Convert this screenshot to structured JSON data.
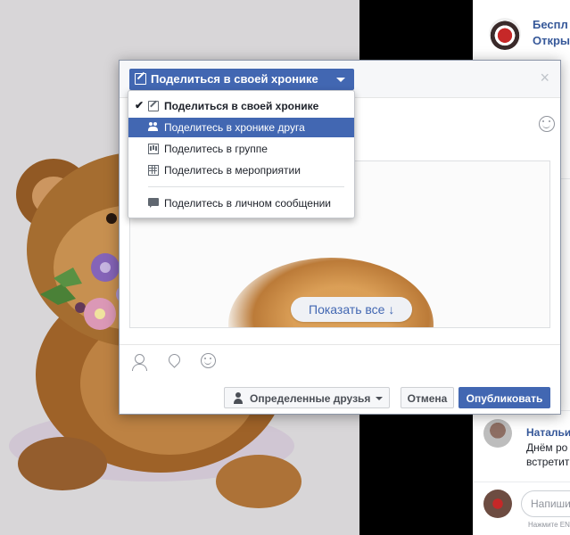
{
  "share_dialog": {
    "title": "Поделиться в своей хронике",
    "close_symbol": "×",
    "attachment": {
      "show_all_label": "Показать все ↓"
    },
    "toolbar_icons": [
      "tag-friends-icon",
      "location-icon",
      "emoji-icon"
    ],
    "audience_label": "Определенные друзья",
    "cancel_label": "Отмена",
    "publish_label": "Опубликовать"
  },
  "share_menu": {
    "items": [
      {
        "label": "Поделиться в своей хронике",
        "icon": "pen-icon",
        "checked": true
      },
      {
        "label": "Поделитесь в хронике друга",
        "icon": "friends-icon",
        "highlighted": true
      },
      {
        "label": "Поделитесь в группе",
        "icon": "group-icon"
      },
      {
        "label": "Поделитесь в мероприятии",
        "icon": "calendar-icon"
      },
      {
        "label": "Поделитесь в личном сообщении",
        "icon": "message-icon"
      }
    ],
    "check_symbol": "✔"
  },
  "sidebar": {
    "page_title_line1": "Беспл",
    "page_title_line2": "Открыт",
    "comment_author": "Натальи",
    "comment_text_line1": "Днём ро",
    "comment_text_line2": "встретит",
    "reply_placeholder": "Напиши",
    "reply_hint": "Нажмите ENT"
  },
  "colors": {
    "primary": "#4267b2",
    "link": "#365899",
    "dialog_header_bg": "#f6f7f9"
  }
}
